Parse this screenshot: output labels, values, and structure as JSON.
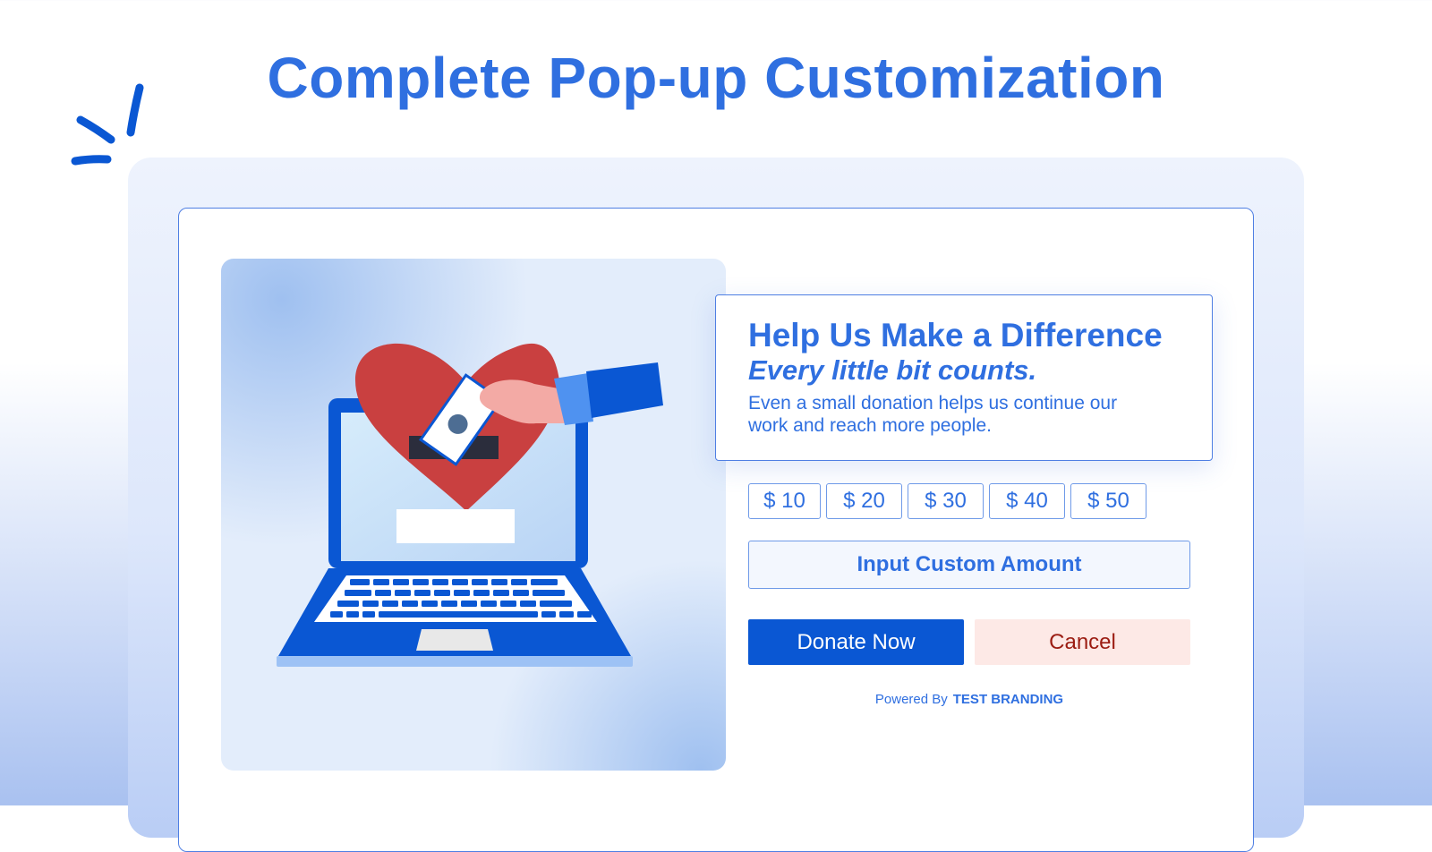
{
  "page": {
    "title": "Complete Pop-up Customization"
  },
  "popup": {
    "heading": "Help Us Make a Difference",
    "subheading": "Every little bit counts.",
    "body": "Even a small donation helps us continue our work and reach more people.",
    "amounts": [
      "$ 10",
      "$ 20",
      "$ 30",
      "$ 40",
      "$ 50"
    ],
    "custom_amount_label": "Input Custom Amount",
    "donate_label": "Donate Now",
    "cancel_label": "Cancel",
    "powered_by_label": "Powered By",
    "brand_name": "TEST BRANDING"
  },
  "colors": {
    "accent": "#2f6fe0",
    "donate_bg": "#0a57d3",
    "cancel_bg": "#fde9e6",
    "cancel_text": "#9b1c12",
    "heart": "#c94040"
  },
  "icons": {
    "decoration": "sparkle-lines-icon",
    "illustration": "laptop-heart-donation-illustration"
  }
}
